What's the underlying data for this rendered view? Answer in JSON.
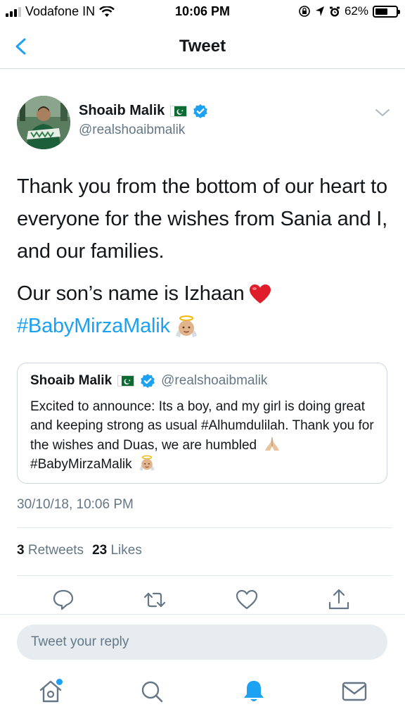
{
  "status_bar": {
    "carrier": "Vodafone IN",
    "time": "10:06 PM",
    "battery": "62%",
    "battery_level": 0.62
  },
  "nav": {
    "title": "Tweet"
  },
  "tweet": {
    "author_name": "Shoaib Malik",
    "handle": "@realshoaibmalik",
    "text_line1": "Thank you from the bottom of our heart to everyone for the wishes from Sania and I, and our families.",
    "text_line2": "Our son’s name is Izhaan",
    "hashtag": "#BabyMirzaMalik",
    "timestamp": "30/10/18, 10:06 PM"
  },
  "quoted_tweet": {
    "author_name": "Shoaib Malik",
    "handle": "@realshoaibmalik",
    "text": "Excited to announce: Its a boy, and my girl is doing great and keeping strong as usual #Alhumdulilah. Thank you for the wishes and Duas, we are humbled",
    "hashtag": "#BabyMirzaMalik"
  },
  "stats": {
    "retweets_count": "3",
    "retweets_label": "Retweets",
    "likes_count": "23",
    "likes_label": "Likes"
  },
  "reply": {
    "placeholder": "Tweet your reply"
  },
  "icons": {
    "back": "back-chevron-icon",
    "more": "chevron-down-icon",
    "reply": "reply-icon",
    "retweet": "retweet-icon",
    "like": "heart-icon",
    "share": "share-icon",
    "home": "home-icon",
    "search": "search-icon",
    "notifications": "bell-icon",
    "messages": "mail-icon"
  },
  "colors": {
    "accent": "#1da1f2",
    "secondary_text": "#657786",
    "divider": "#e1e8ed"
  }
}
